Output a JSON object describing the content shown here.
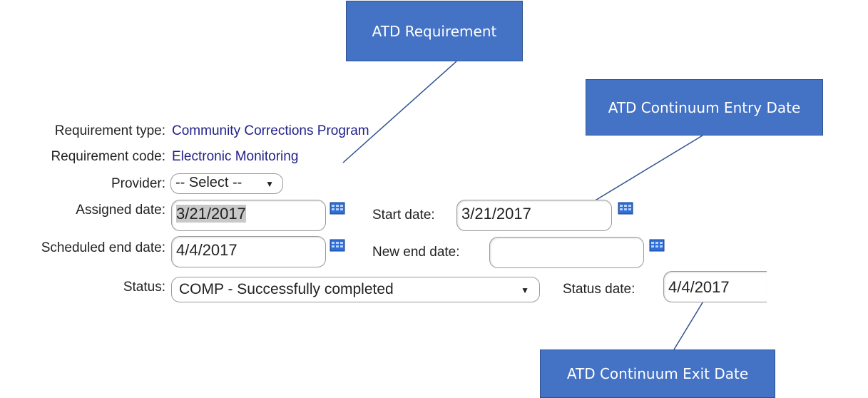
{
  "callouts": {
    "requirement": "ATD Requirement",
    "entry": "ATD Continuum Entry Date",
    "exit": "ATD Continuum Exit Date"
  },
  "form": {
    "requirement_type_label": "Requirement type:",
    "requirement_type_value": "Community Corrections Program",
    "requirement_code_label": "Requirement code:",
    "requirement_code_value": "Electronic Monitoring",
    "provider_label": "Provider:",
    "provider_value": "-- Select --",
    "assigned_date_label": "Assigned date:",
    "assigned_date_value": "3/21/2017",
    "start_date_label": "Start date:",
    "start_date_value": "3/21/2017",
    "scheduled_end_label": "Scheduled end date:",
    "scheduled_end_value": "4/4/2017",
    "new_end_label": "New end date:",
    "new_end_value": "",
    "status_label": "Status:",
    "status_value": "COMP - Successfully completed",
    "status_date_label": "Status date:",
    "status_date_value": "4/4/2017"
  },
  "colors": {
    "callout": "#4472c4",
    "link": "#1f1f8a"
  },
  "icons": {
    "calendar": "calendar-icon",
    "dropdown": "chevron-down-icon"
  }
}
